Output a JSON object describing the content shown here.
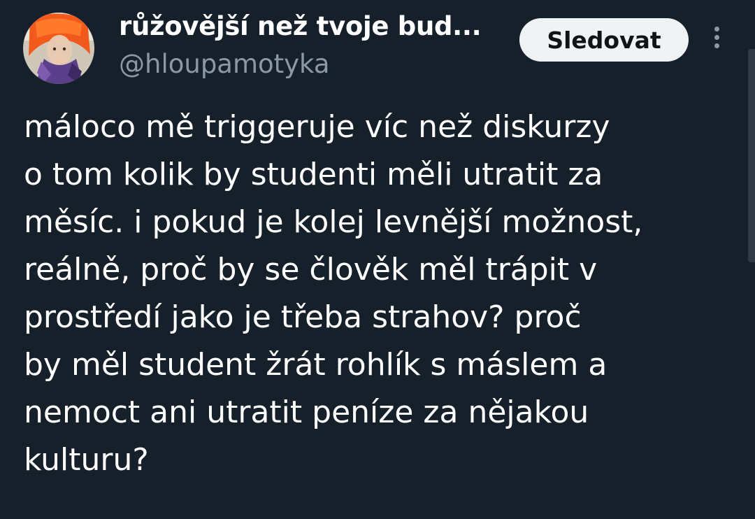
{
  "tweet": {
    "author": {
      "display_name": "růžovější než tvoje bud...",
      "handle": "@hloupamotyka"
    },
    "follow_label": "Sledovat",
    "text_lines": [
      "máloco mě triggeruje víc než diskurzy",
      "o tom kolik by studenti měli utratit za",
      "měsíc. i pokud je kolej levnější možnost,",
      "reálně, proč by se člověk měl trápit v",
      "prostředí jako je třeba strahov? proč",
      "by měl student žrát rohlík s máslem a",
      "nemoct ani utratit peníze za nějakou",
      "kulturu?"
    ]
  },
  "icons": {
    "more": "more-vertical-icon",
    "avatar": "profile-photo"
  },
  "colors": {
    "background": "#15202b",
    "text": "#ffffff",
    "secondary_text": "#8b98a5",
    "button_bg": "#eff3f4",
    "button_text": "#0f1419"
  }
}
